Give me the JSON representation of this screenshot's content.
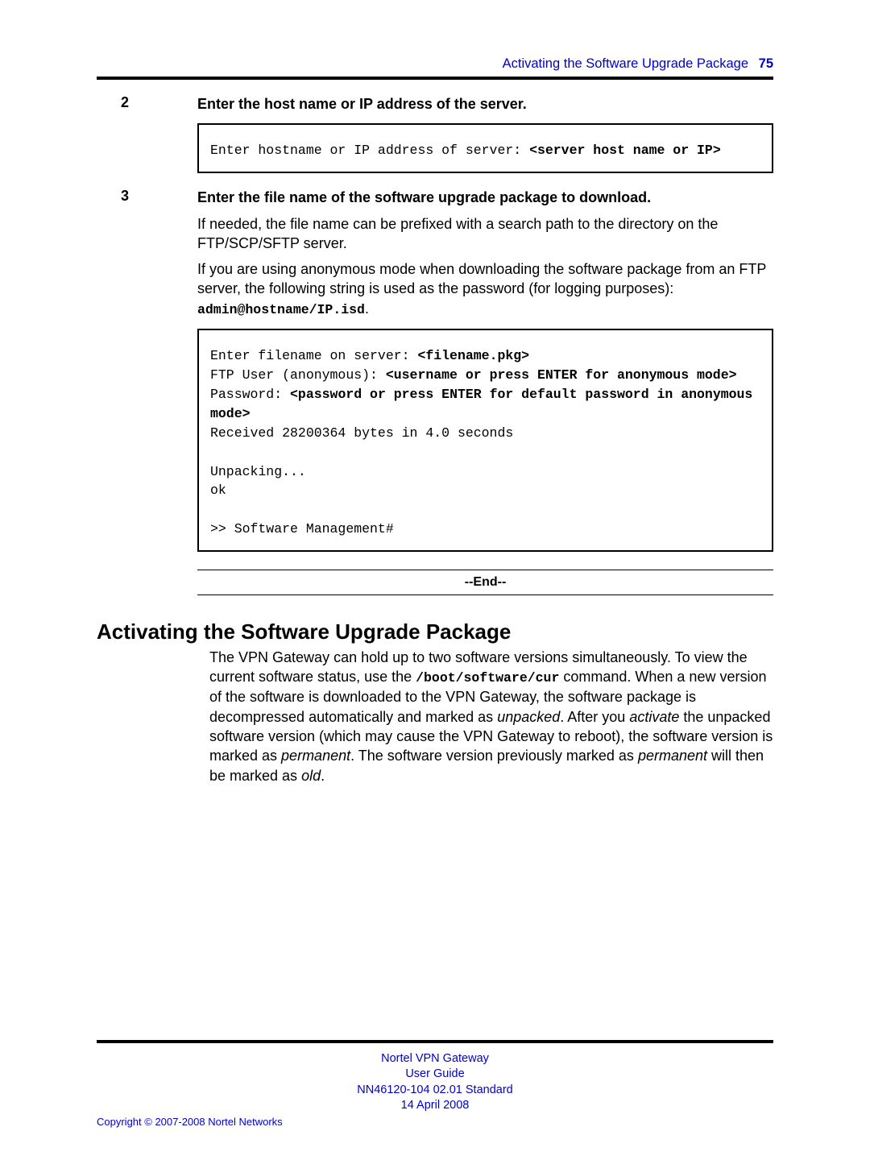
{
  "header": {
    "title": "Activating the Software Upgrade Package",
    "page_no": "75"
  },
  "steps": [
    {
      "num": "2",
      "title": "Enter the host name or IP address of the server.",
      "code_plain1": "Enter hostname or IP address of server: ",
      "code_bold1": "<server host name or IP>"
    },
    {
      "num": "3",
      "title_pre": " Enter the file name of the software upgrade package to download.",
      "para1": "If needed, the file name can be prefixed with a search path to the directory on the FTP/SCP/SFTP server.",
      "para2a": "If you are using anonymous mode when downloading the software package from an FTP server, the following string is used as the password (for logging purposes): ",
      "para2_mono": "admin@hostname/IP.isd",
      "para2b": ".",
      "code": {
        "l1a": "Enter filename on server: ",
        "l1b": "<filename.pkg>",
        "l2a": "FTP User (anonymous): ",
        "l2b": "<username or press ENTER for anonymous mode>",
        "l3a": "Password: ",
        "l3b": "<password or press ENTER for default password in anonymous mode>",
        "l4": "Received 28200364 bytes in 4.0 seconds",
        "l5": "Unpacking...",
        "l6": "ok",
        "l7": ">> Software Management#"
      }
    }
  ],
  "end_label": "--End--",
  "section": {
    "heading": "Activating the Software Upgrade Package",
    "p_a": "The VPN Gateway can hold up to two software versions simultaneously. To view the current software status, use the ",
    "p_mono": "/boot/software/cur",
    "p_b": " command. When a new version of the software is downloaded to the VPN Gateway, the software package is decompressed automatically and marked as ",
    "p_i1": "unpacked",
    "p_c": ". After you ",
    "p_i2": "activate",
    "p_d": " the unpacked software version (which may cause the VPN Gateway to reboot), the software version is marked as ",
    "p_i3": "permanent",
    "p_e": ". The software version previously marked as ",
    "p_i4": "permanent",
    "p_f": " will then be marked as ",
    "p_i5": "old",
    "p_g": "."
  },
  "footer": {
    "l1": "Nortel VPN Gateway",
    "l2": "User Guide",
    "l3a": "NN46120-104   02.01   ",
    "l3b": "Standard",
    "l4": "14 April 2008",
    "copyright": "Copyright © 2007-2008 Nortel Networks"
  }
}
